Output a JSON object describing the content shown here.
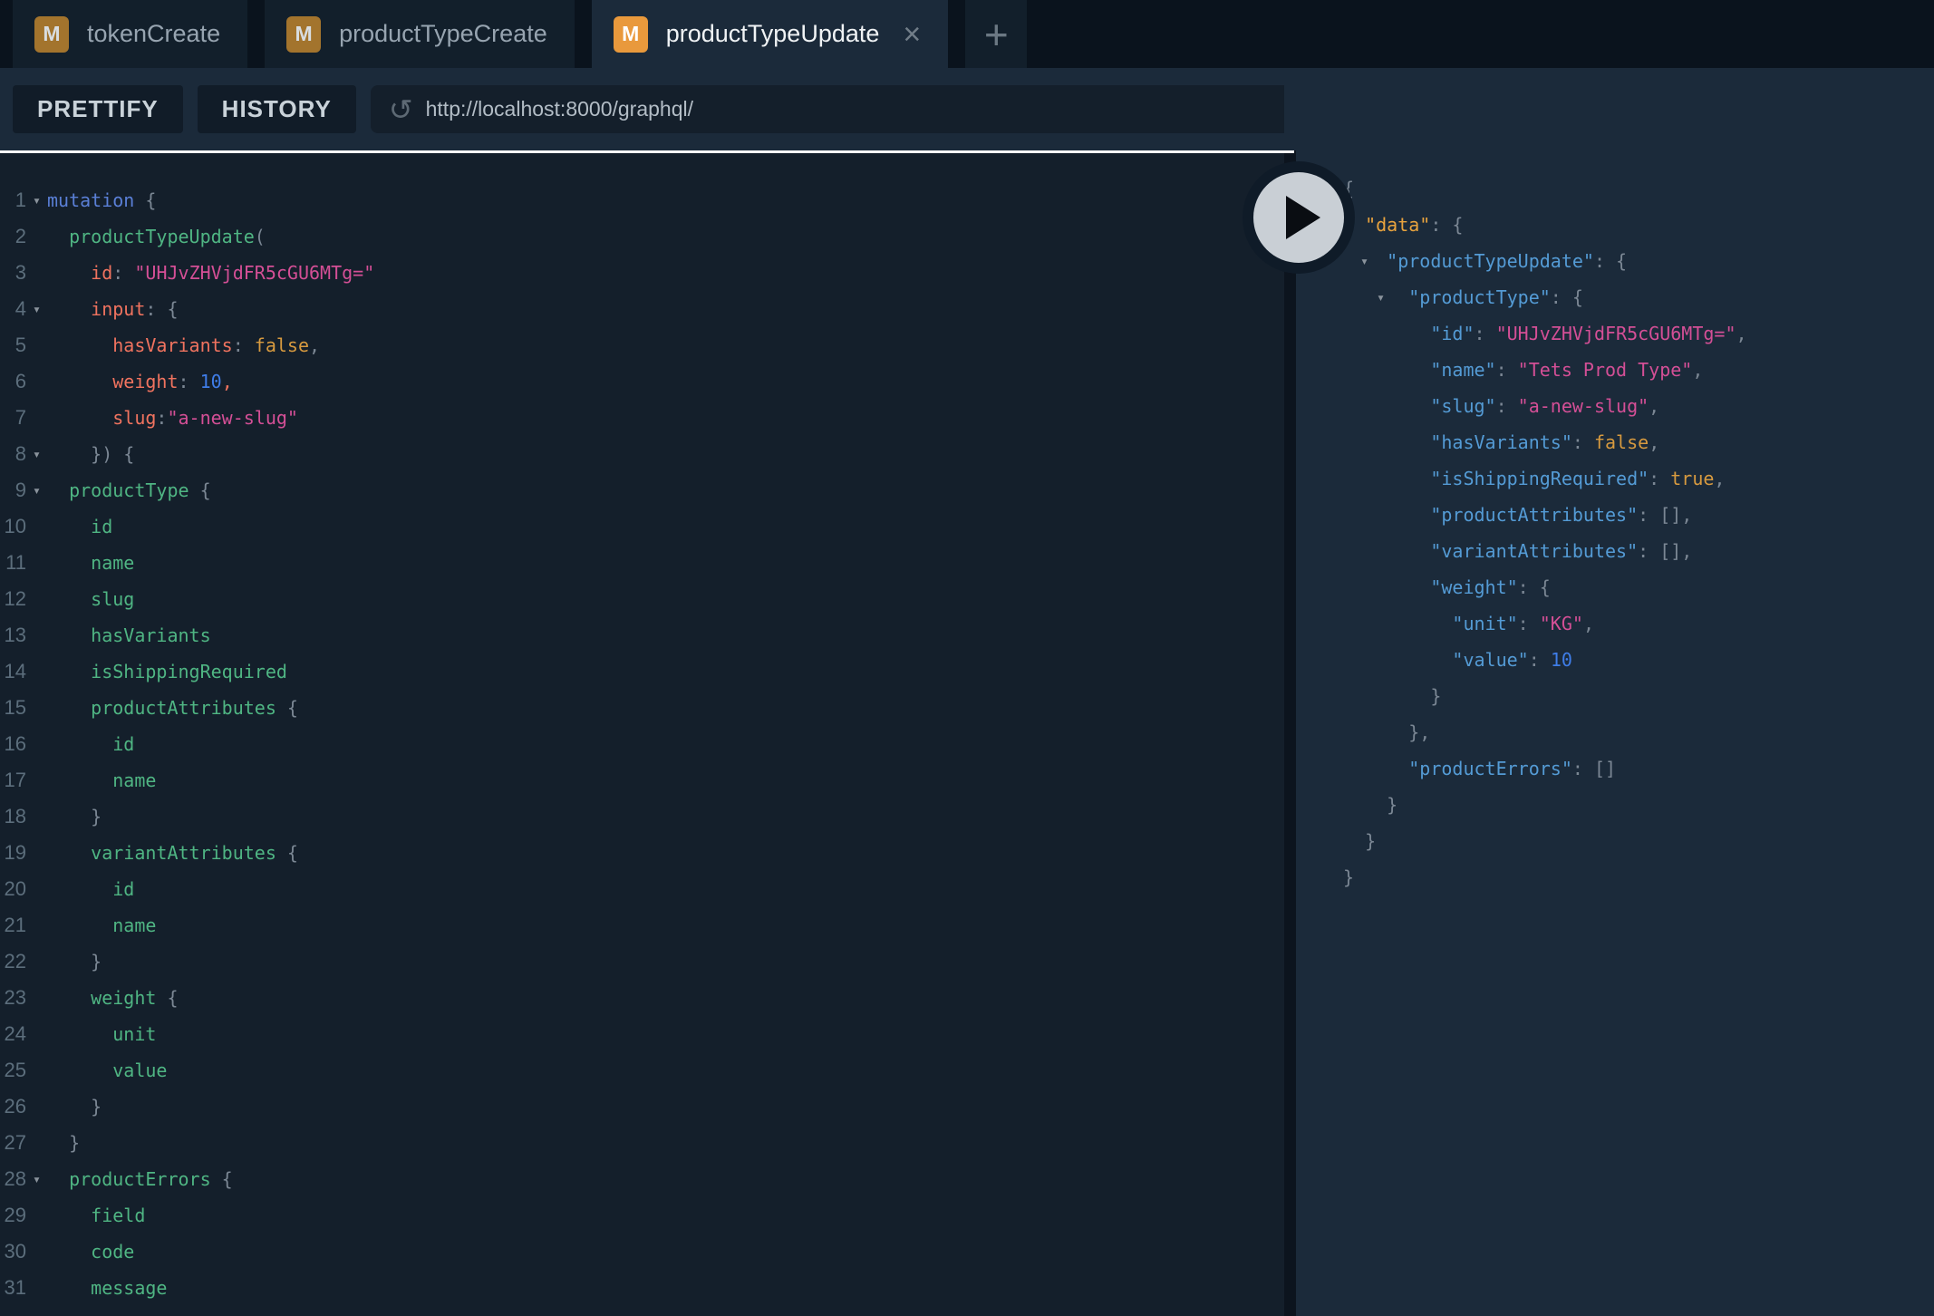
{
  "colors": {
    "tabbar_bg": "#0a131d",
    "tab_bg": "#121f2b",
    "tab_active_bg": "#1b2a3a",
    "tab_text": "#97a4b0",
    "tab_active_text": "#f0f3f5",
    "badge_bg": "#a3742d",
    "badge_active_bg": "#e9993c",
    "badge_text": "#d8dde1",
    "badge_active_text": "#ffffff",
    "toolbar_bg": "#1b2a3a",
    "button_bg": "#111c28",
    "button_text": "#c9d2d9",
    "url_bg": "#141f2b",
    "url_text": "#b3bdc6",
    "icon": "#5d6974",
    "editor_bg": "#141f2b",
    "pane_bg": "#1b2a3a",
    "divider": "#0c141e",
    "rule": "#ffffff",
    "gutter": "#5c6e7c",
    "arrow": "#8a939c",
    "kw": "#5a7fd6",
    "fld": "#4fb583",
    "arg": "#f0735f",
    "str": "#d44f96",
    "num": "#3f7de8",
    "bool": "#d79a3f",
    "p": "#7b8794",
    "red": "#f0735f",
    "key": "#549bd5",
    "okey": "#e8a33e",
    "play_ring": "#0f1b28",
    "play_bg": "#c9cfd5",
    "play_icon": "#0a0d12"
  },
  "tabs": {
    "items": [
      {
        "badge": "M",
        "label": "tokenCreate",
        "active": false,
        "closable": false
      },
      {
        "badge": "M",
        "label": "productTypeCreate",
        "active": false,
        "closable": false
      },
      {
        "badge": "M",
        "label": "productTypeUpdate",
        "active": true,
        "closable": true
      }
    ],
    "close_glyph": "×",
    "new_tab_label": "+"
  },
  "toolbar": {
    "prettify_label": "PRETTIFY",
    "history_label": "HISTORY",
    "reload_glyph": "↺",
    "url": "http://localhost:8000/graphql/"
  },
  "editor": {
    "fold_glyph": "▾",
    "lines": [
      [
        1,
        1,
        0,
        [
          [
            "kw",
            "mutation"
          ],
          [
            "p",
            " {"
          ]
        ]
      ],
      [
        2,
        0,
        1,
        [
          [
            "fld",
            "productTypeUpdate"
          ],
          [
            "p",
            "("
          ]
        ]
      ],
      [
        3,
        0,
        2,
        [
          [
            "arg",
            "id"
          ],
          [
            "p",
            ": "
          ],
          [
            "str",
            "\"UHJvZHVjdFR5cGU6MTg=\""
          ]
        ]
      ],
      [
        4,
        1,
        2,
        [
          [
            "arg",
            "input"
          ],
          [
            "p",
            ": {"
          ]
        ]
      ],
      [
        5,
        0,
        3,
        [
          [
            "arg",
            "hasVariants"
          ],
          [
            "p",
            ": "
          ],
          [
            "bool",
            "false"
          ],
          [
            "p",
            ","
          ]
        ]
      ],
      [
        6,
        0,
        3,
        [
          [
            "arg",
            "weight"
          ],
          [
            "p",
            ": "
          ],
          [
            "num",
            "10"
          ],
          [
            "red",
            ","
          ]
        ]
      ],
      [
        7,
        0,
        3,
        [
          [
            "arg",
            "slug"
          ],
          [
            "p",
            ":"
          ],
          [
            "str",
            "\"a-new-slug\""
          ]
        ]
      ],
      [
        8,
        1,
        2,
        [
          [
            "p",
            "}) {"
          ]
        ]
      ],
      [
        9,
        1,
        1,
        [
          [
            "fld",
            "productType"
          ],
          [
            "p",
            " {"
          ]
        ]
      ],
      [
        10,
        0,
        2,
        [
          [
            "fld",
            "id"
          ]
        ]
      ],
      [
        11,
        0,
        2,
        [
          [
            "fld",
            "name"
          ]
        ]
      ],
      [
        12,
        0,
        2,
        [
          [
            "fld",
            "slug"
          ]
        ]
      ],
      [
        13,
        0,
        2,
        [
          [
            "fld",
            "hasVariants"
          ]
        ]
      ],
      [
        14,
        0,
        2,
        [
          [
            "fld",
            "isShippingRequired"
          ]
        ]
      ],
      [
        15,
        0,
        2,
        [
          [
            "fld",
            "productAttributes"
          ],
          [
            "p",
            " {"
          ]
        ]
      ],
      [
        16,
        0,
        3,
        [
          [
            "fld",
            "id"
          ]
        ]
      ],
      [
        17,
        0,
        3,
        [
          [
            "fld",
            "name"
          ]
        ]
      ],
      [
        18,
        0,
        2,
        [
          [
            "p",
            "}"
          ]
        ]
      ],
      [
        19,
        0,
        2,
        [
          [
            "fld",
            "variantAttributes"
          ],
          [
            "p",
            " {"
          ]
        ]
      ],
      [
        20,
        0,
        3,
        [
          [
            "fld",
            "id"
          ]
        ]
      ],
      [
        21,
        0,
        3,
        [
          [
            "fld",
            "name"
          ]
        ]
      ],
      [
        22,
        0,
        2,
        [
          [
            "p",
            "}"
          ]
        ]
      ],
      [
        23,
        0,
        2,
        [
          [
            "fld",
            "weight"
          ],
          [
            "p",
            " {"
          ]
        ]
      ],
      [
        24,
        0,
        3,
        [
          [
            "fld",
            "unit"
          ]
        ]
      ],
      [
        25,
        0,
        3,
        [
          [
            "fld",
            "value"
          ]
        ]
      ],
      [
        26,
        0,
        2,
        [
          [
            "p",
            "}"
          ]
        ]
      ],
      [
        27,
        0,
        1,
        [
          [
            "p",
            "}"
          ]
        ]
      ],
      [
        28,
        1,
        1,
        [
          [
            "fld",
            "productErrors"
          ],
          [
            "p",
            " {"
          ]
        ]
      ],
      [
        29,
        0,
        2,
        [
          [
            "fld",
            "field"
          ]
        ]
      ],
      [
        30,
        0,
        2,
        [
          [
            "fld",
            "code"
          ]
        ]
      ],
      [
        31,
        0,
        2,
        [
          [
            "fld",
            "message"
          ]
        ]
      ]
    ]
  },
  "response": {
    "lines": [
      [
        1,
        0,
        [
          [
            "p",
            "{"
          ]
        ]
      ],
      [
        1,
        1,
        [
          [
            "okey",
            "\"data\""
          ],
          [
            "p",
            ": {"
          ]
        ]
      ],
      [
        1,
        2,
        [
          [
            "key",
            "\"productTypeUpdate\""
          ],
          [
            "p",
            ": {"
          ]
        ]
      ],
      [
        1,
        3,
        [
          [
            "key",
            "\"productType\""
          ],
          [
            "p",
            ": {"
          ]
        ]
      ],
      [
        0,
        4,
        [
          [
            "key",
            "\"id\""
          ],
          [
            "p",
            ": "
          ],
          [
            "str",
            "\"UHJvZHVjdFR5cGU6MTg=\""
          ],
          [
            "p",
            ","
          ]
        ]
      ],
      [
        0,
        4,
        [
          [
            "key",
            "\"name\""
          ],
          [
            "p",
            ": "
          ],
          [
            "str",
            "\"Tets Prod Type\""
          ],
          [
            "p",
            ","
          ]
        ]
      ],
      [
        0,
        4,
        [
          [
            "key",
            "\"slug\""
          ],
          [
            "p",
            ": "
          ],
          [
            "str",
            "\"a-new-slug\""
          ],
          [
            "p",
            ","
          ]
        ]
      ],
      [
        0,
        4,
        [
          [
            "key",
            "\"hasVariants\""
          ],
          [
            "p",
            ": "
          ],
          [
            "bool",
            "false"
          ],
          [
            "p",
            ","
          ]
        ]
      ],
      [
        0,
        4,
        [
          [
            "key",
            "\"isShippingRequired\""
          ],
          [
            "p",
            ": "
          ],
          [
            "bool",
            "true"
          ],
          [
            "p",
            ","
          ]
        ]
      ],
      [
        0,
        4,
        [
          [
            "key",
            "\"productAttributes\""
          ],
          [
            "p",
            ": [],"
          ]
        ]
      ],
      [
        0,
        4,
        [
          [
            "key",
            "\"variantAttributes\""
          ],
          [
            "p",
            ": [],"
          ]
        ]
      ],
      [
        0,
        4,
        [
          [
            "key",
            "\"weight\""
          ],
          [
            "p",
            ": {"
          ]
        ]
      ],
      [
        0,
        5,
        [
          [
            "key",
            "\"unit\""
          ],
          [
            "p",
            ": "
          ],
          [
            "str",
            "\"KG\""
          ],
          [
            "p",
            ","
          ]
        ]
      ],
      [
        0,
        5,
        [
          [
            "key",
            "\"value\""
          ],
          [
            "p",
            ": "
          ],
          [
            "num",
            "10"
          ]
        ]
      ],
      [
        0,
        4,
        [
          [
            "p",
            "}"
          ]
        ]
      ],
      [
        0,
        3,
        [
          [
            "p",
            "},"
          ]
        ]
      ],
      [
        0,
        3,
        [
          [
            "key",
            "\"productErrors\""
          ],
          [
            "p",
            ": []"
          ]
        ]
      ],
      [
        0,
        2,
        [
          [
            "p",
            "}"
          ]
        ]
      ],
      [
        0,
        1,
        [
          [
            "p",
            "}"
          ]
        ]
      ],
      [
        0,
        0,
        [
          [
            "p",
            "}"
          ]
        ]
      ]
    ]
  }
}
